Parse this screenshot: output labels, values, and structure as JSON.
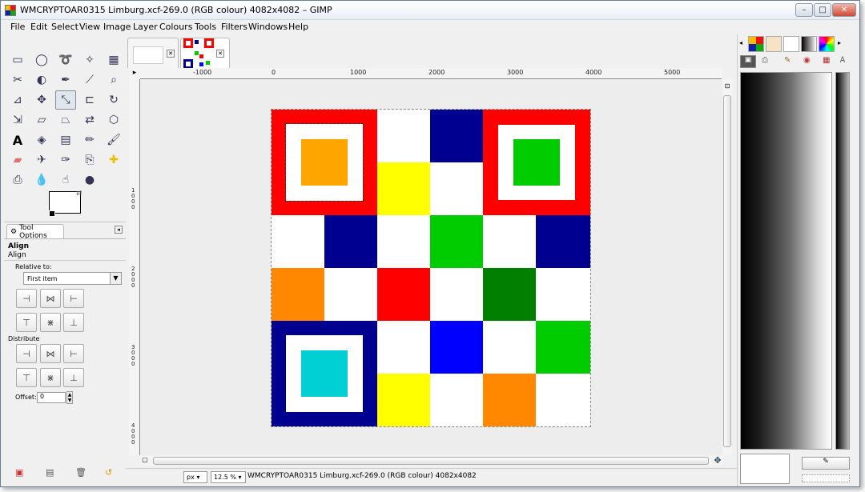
{
  "window": {
    "title": "WMCRYPTOAR0315 Limburg.xcf-269.0 (RGB colour) 4082x4082 – GIMP",
    "controls": {
      "minimize": "–",
      "maximize": "□",
      "close": "✕"
    }
  },
  "menubar": {
    "items": [
      "File",
      "Edit",
      "Select",
      "View",
      "Image",
      "Layer",
      "Colours",
      "Tools",
      "Filters",
      "Windows",
      "Help"
    ]
  },
  "toolbox": {
    "tools": [
      "rect-select-icon",
      "ellipse-select-icon",
      "free-select-icon",
      "fuzzy-select-icon",
      "colour-select-icon",
      "scissors-icon",
      "foreground-select-icon",
      "paths-icon",
      "colour-picker-icon",
      "zoom-icon",
      "measure-icon",
      "move-icon",
      "align-icon",
      "crop-icon",
      "rotate-icon",
      "scale-icon",
      "shear-icon",
      "perspective-icon",
      "flip-icon",
      "cage-transform-icon",
      "text-icon",
      "bucket-fill-icon",
      "blend-icon",
      "pencil-icon",
      "paintbrush-icon",
      "eraser-icon",
      "airbrush-icon",
      "ink-icon",
      "clone-icon",
      "heal-icon",
      "perspective-clone-icon",
      "blur-icon",
      "smudge-icon",
      "dodge-burn-icon"
    ],
    "active_tool": "align-icon"
  },
  "tool_options": {
    "tab_label": "Tool Options",
    "heading": "Align",
    "subheading": "Align",
    "relative_to_label": "Relative to:",
    "relative_to_value": "First item",
    "distribute_label": "Distribute",
    "offset_label": "Offset:",
    "offset_value": "0"
  },
  "rulers": {
    "horizontal": [
      "-1000",
      "0",
      "1000",
      "2000",
      "3000",
      "4000",
      "5000"
    ],
    "vertical": [
      "1000",
      "2000",
      "3000",
      "4000"
    ]
  },
  "image_colors": {
    "red": "#ff0000",
    "orange": "#ffa500",
    "dark_orange": "#ff8800",
    "yellow": "#ffff00",
    "navy": "#000090",
    "green": "#00cc00",
    "dark_green": "#007f00",
    "blue": "#0000ff",
    "cyan": "#00cfd4",
    "white": "#ffffff"
  },
  "statusbar": {
    "unit": "px",
    "zoom": "12.5 %",
    "info": "WMCRYPTOAR0315 Limburg.xcf-269.0 (RGB colour) 4082x4082"
  }
}
